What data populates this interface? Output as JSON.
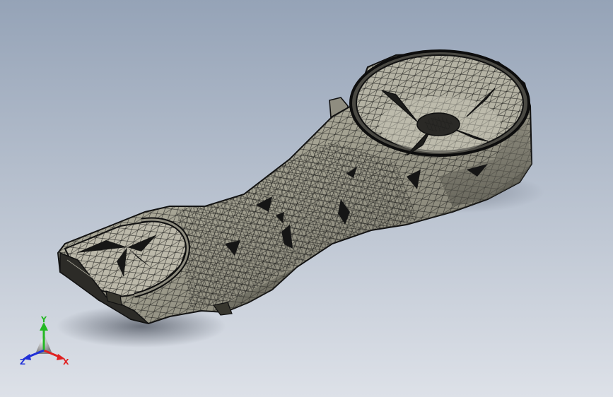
{
  "viewport": {
    "background_top": "#95a3b7",
    "background_bottom": "#dde1e8"
  },
  "model": {
    "render_style": "shaded-with-mesh-edges",
    "surface_color": "#a9a797",
    "edge_color": "#1a1a1a"
  },
  "triad": {
    "x_label": "X",
    "y_label": "Y",
    "z_label": "Z",
    "x_color": "#e02020",
    "y_color": "#22b822",
    "z_color": "#2030d8"
  }
}
